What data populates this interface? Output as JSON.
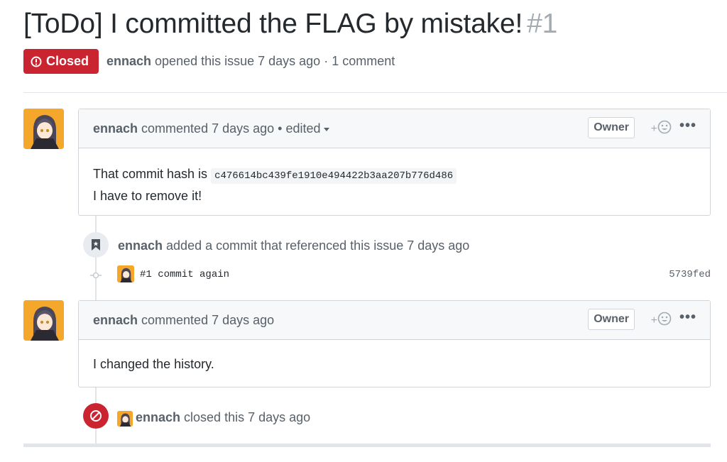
{
  "issue": {
    "title": "[ToDo] I committed the FLAG by mistake!",
    "number": "#1",
    "state_label": "Closed",
    "state_color": "#cb2431",
    "author": "ennach",
    "opened_text": " opened this issue 7 days ago · 1 comment"
  },
  "comments": [
    {
      "author": "ennach",
      "meta_text": " commented 7 days ago",
      "edited_text": " • edited",
      "owner_label": "Owner",
      "react_label": "+",
      "more_label": "•••",
      "body_line1": "That commit hash is ",
      "body_code": "c476614bc439fe1910e494422b3aa207b776d486",
      "body_line2": "I have to remove it!"
    },
    {
      "author": "ennach",
      "meta_text": " commented 7 days ago",
      "owner_label": "Owner",
      "react_label": "+",
      "more_label": "•••",
      "body_line1": "I changed the history."
    }
  ],
  "events": {
    "reference": {
      "author": "ennach",
      "text": " added a commit that referenced this issue 7 days ago",
      "icon": "bookmark-icon"
    },
    "commit": {
      "message": "#1 commit again",
      "sha": "5739fed"
    },
    "closed": {
      "author": "ennach",
      "text": " closed this 7 days ago",
      "icon": "closed-circle-icon",
      "color": "#cb2431"
    }
  }
}
